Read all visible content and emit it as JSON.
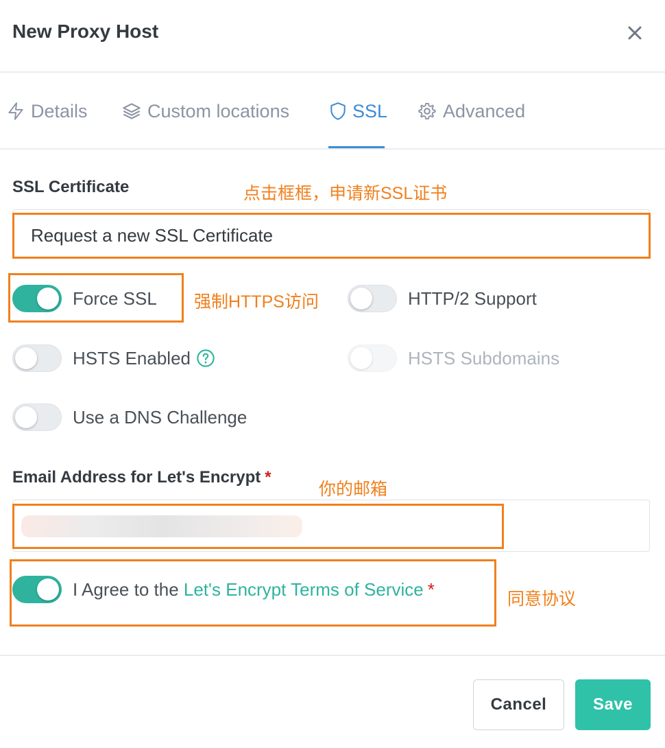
{
  "modal": {
    "title": "New Proxy Host"
  },
  "tabs": [
    {
      "label": "Details",
      "icon": "lightning-icon"
    },
    {
      "label": "Custom locations",
      "icon": "layers-icon"
    },
    {
      "label": "SSL",
      "icon": "shield-icon",
      "active": true
    },
    {
      "label": "Advanced",
      "icon": "gear-icon"
    }
  ],
  "ssl": {
    "certificate_label": "SSL Certificate",
    "certificate_value": "Request a new SSL Certificate",
    "force_ssl": {
      "label": "Force SSL",
      "enabled": true
    },
    "http2": {
      "label": "HTTP/2 Support",
      "enabled": false
    },
    "hsts": {
      "label": "HSTS Enabled",
      "enabled": false
    },
    "hsts_subdomains": {
      "label": "HSTS Subdomains",
      "enabled": false,
      "disabled": true
    },
    "dns_challenge": {
      "label": "Use a DNS Challenge",
      "enabled": false
    },
    "email_label": "Email Address for Let's Encrypt",
    "required_mark": "*",
    "agree": {
      "prefix": "I Agree to the ",
      "link": "Let's Encrypt Terms of Service",
      "enabled": true
    }
  },
  "footer": {
    "cancel_label": "Cancel",
    "save_label": "Save"
  },
  "annotations": {
    "certificate": "点击框框，申请新SSL证书",
    "force_ssl": "强制HTTPS访问",
    "email": "你的邮箱",
    "agree": "同意协议"
  },
  "colors": {
    "accent": "#2fb39f",
    "tab_active": "#3d8bd6",
    "annotation": "#f0801d",
    "required": "#cd201f"
  }
}
